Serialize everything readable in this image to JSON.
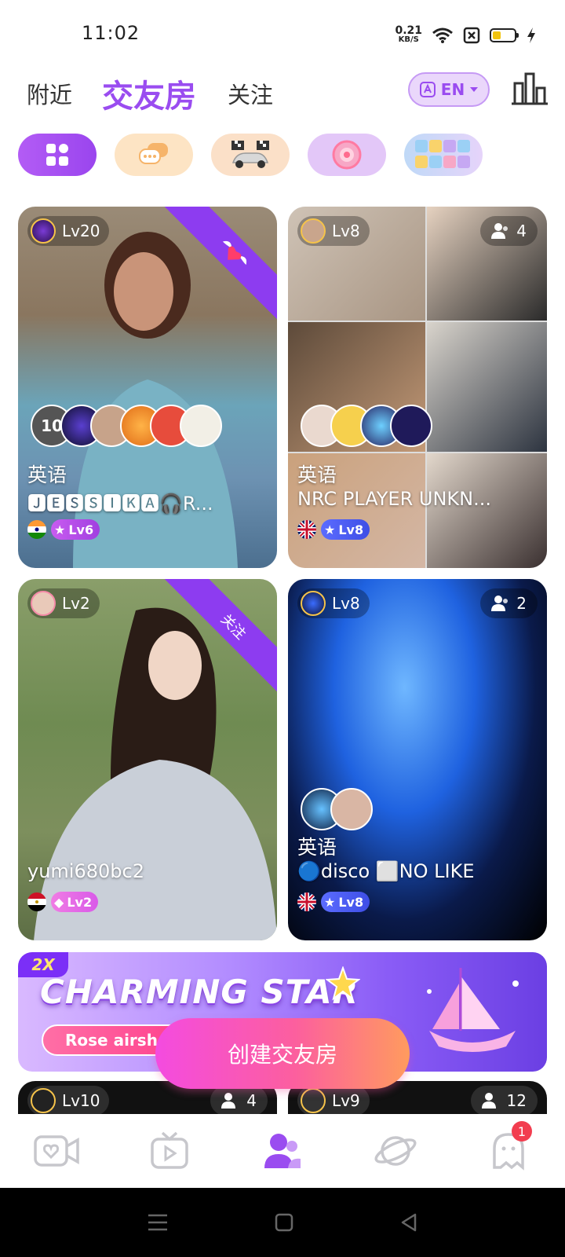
{
  "status_bar": {
    "time": "11:02",
    "net_speed_value": "0.21",
    "net_speed_unit": "KB/S",
    "battery_level": 0.4
  },
  "header": {
    "tabs": [
      {
        "label": "附近"
      },
      {
        "label": "交友房",
        "active": true
      },
      {
        "label": "关注"
      }
    ],
    "language_button": "EN",
    "rank_icon": "bar-chart-icon"
  },
  "categories": [
    {
      "icon": "grid-icon",
      "selected": true
    },
    {
      "icon": "chat-bubbles-icon"
    },
    {
      "icon": "race-car-icon"
    },
    {
      "icon": "wheel-icon"
    },
    {
      "icon": "number-puzzle-icon"
    }
  ],
  "rooms": [
    {
      "level": "Lv20",
      "ribbon": "heart-wings-icon",
      "avatar_count": "10",
      "language": "英语",
      "title": "🅹🅴🆂🆂🅸🅺🅰🎧R...",
      "flag": "india-flag-icon",
      "host_level": "Lv6"
    },
    {
      "level": "Lv8",
      "members": "4",
      "language": "英语",
      "title": "NRC PLAYER UNKN...",
      "flag": "uk-flag-icon",
      "host_level": "Lv8"
    },
    {
      "level": "Lv2",
      "ribbon_text": "关注",
      "title": "yumi680bc2",
      "flag": "egypt-flag-icon",
      "host_level": "Lv2"
    },
    {
      "level": "Lv8",
      "members": "2",
      "language": "英语",
      "title": "🔵disco ⬜NO LIKE",
      "flag": "uk-flag-icon",
      "host_level": "Lv8"
    },
    {
      "level": "Lv10",
      "members": "4"
    },
    {
      "level": "Lv9",
      "members": "12"
    }
  ],
  "banner": {
    "tag": "2X",
    "title": "CHARMING STAR",
    "subtitle": "Rose airsh"
  },
  "create_button": "创建交友房",
  "bottom_nav": [
    {
      "icon": "video-heart-icon"
    },
    {
      "icon": "tv-play-icon"
    },
    {
      "icon": "users-icon",
      "active": true
    },
    {
      "icon": "planet-icon"
    },
    {
      "icon": "ghost-chat-icon",
      "badge": "1"
    }
  ],
  "colors": {
    "accent": "#9a4cf0",
    "create_gradient_start": "#f44be0",
    "create_gradient_end": "#ff9b5e",
    "badge": "#f23d4f"
  }
}
